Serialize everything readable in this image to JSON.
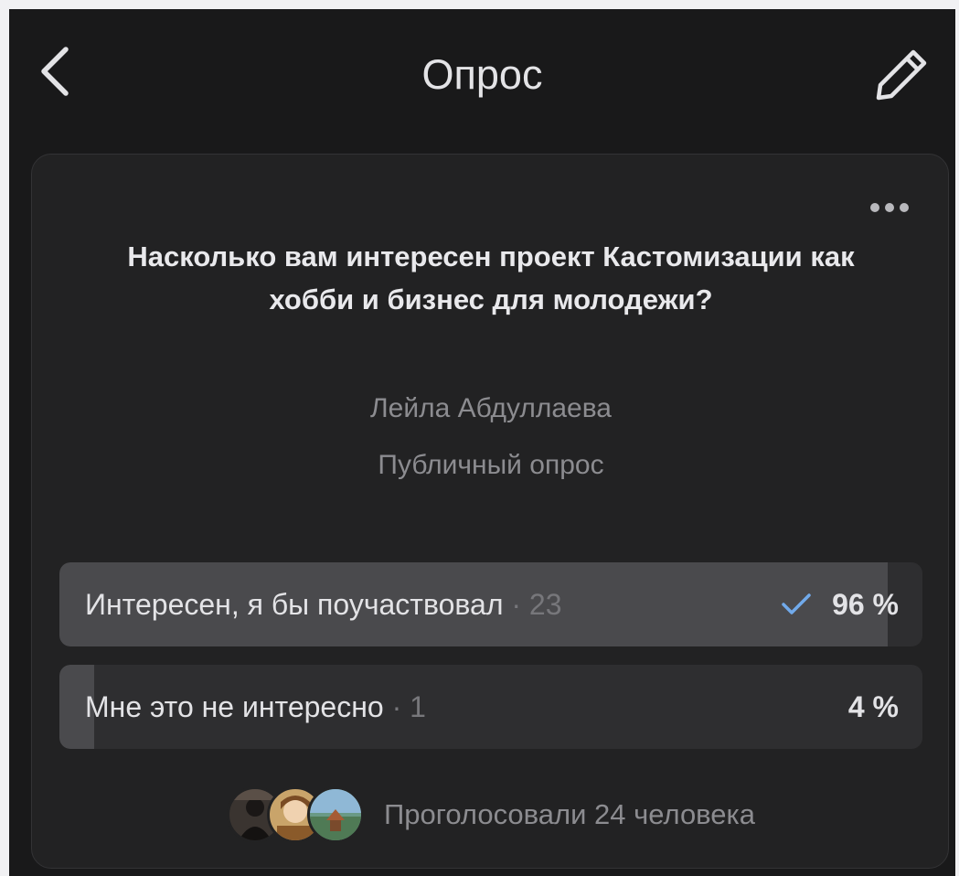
{
  "header": {
    "title": "Опрос",
    "back_icon": "chevron-left-icon",
    "edit_icon": "pencil-icon"
  },
  "poll": {
    "more_icon": "more-horizontal-icon",
    "question": "Насколько вам интересен проект Кастомизации как хобби и бизнес для молодежи?",
    "author": "Лейла Абдуллаева",
    "type": "Публичный опрос",
    "options": [
      {
        "label": "Интересен, я бы поучаствовал",
        "separator": "·",
        "count": "23",
        "percent": "96 %",
        "fraction": 0.96,
        "selected": true
      },
      {
        "label": "Мне это не интересно",
        "separator": "·",
        "count": "1",
        "percent": "4 %",
        "fraction": 0.04,
        "selected": false
      }
    ],
    "voters_text": "Проголосовали 24 человека"
  },
  "colors": {
    "background": "#19191a",
    "card": "#222223",
    "option_track": "#2e2e30",
    "option_fill": "#4a4a4d",
    "accent_check": "#71aaeb",
    "text_primary": "#e3e3e6",
    "text_secondary": "#8c8c90"
  }
}
